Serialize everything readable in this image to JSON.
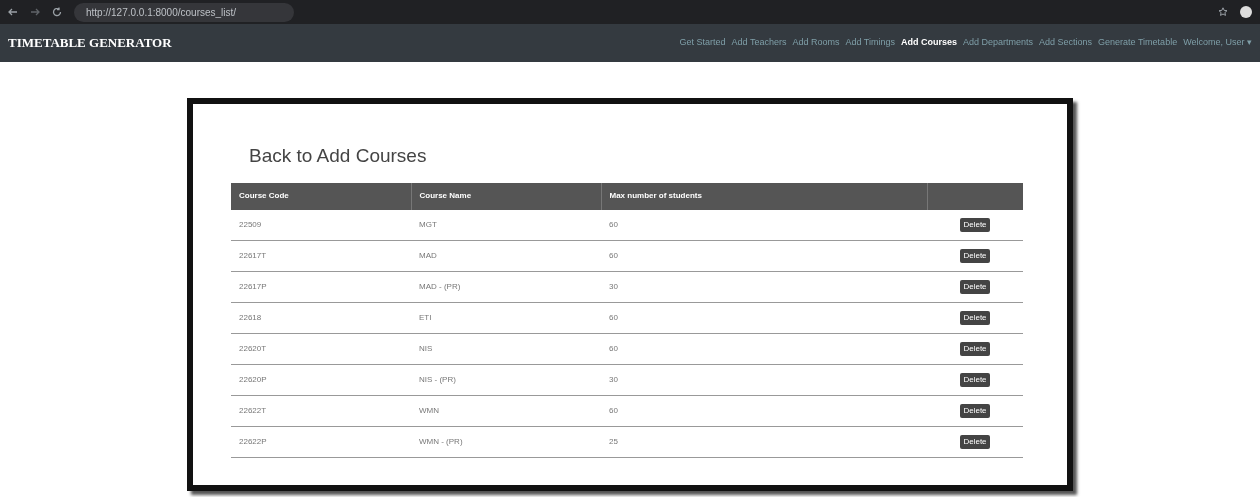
{
  "browser": {
    "url": "http://127.0.0.1:8000/courses_list/"
  },
  "navbar": {
    "brand": "TIMETABLE GENERATOR",
    "links": [
      {
        "label": "Get Started",
        "selected": false
      },
      {
        "label": "Add Teachers",
        "selected": false
      },
      {
        "label": "Add Rooms",
        "selected": false
      },
      {
        "label": "Add Timings",
        "selected": false
      },
      {
        "label": "Add Courses",
        "selected": true
      },
      {
        "label": "Add Departments",
        "selected": false
      },
      {
        "label": "Add Sections",
        "selected": false
      },
      {
        "label": "Generate Timetable",
        "selected": false
      }
    ],
    "user": "Welcome, User ▾"
  },
  "heading": "Back to Add Courses",
  "table": {
    "columns": [
      "Course Code",
      "Course Name",
      "Max number of students"
    ],
    "rows": [
      {
        "code": "22509",
        "name": "MGT",
        "max": "60",
        "action": "Delete"
      },
      {
        "code": "22617T",
        "name": "MAD",
        "max": "60",
        "action": "Delete"
      },
      {
        "code": "22617P",
        "name": "MAD - (PR)",
        "max": "30",
        "action": "Delete"
      },
      {
        "code": "22618",
        "name": "ETI",
        "max": "60",
        "action": "Delete"
      },
      {
        "code": "22620T",
        "name": "NIS",
        "max": "60",
        "action": "Delete"
      },
      {
        "code": "22620P",
        "name": "NIS - (PR)",
        "max": "30",
        "action": "Delete"
      },
      {
        "code": "22622T",
        "name": "WMN",
        "max": "60",
        "action": "Delete"
      },
      {
        "code": "22622P",
        "name": "WMN - (PR)",
        "max": "25",
        "action": "Delete"
      }
    ]
  }
}
